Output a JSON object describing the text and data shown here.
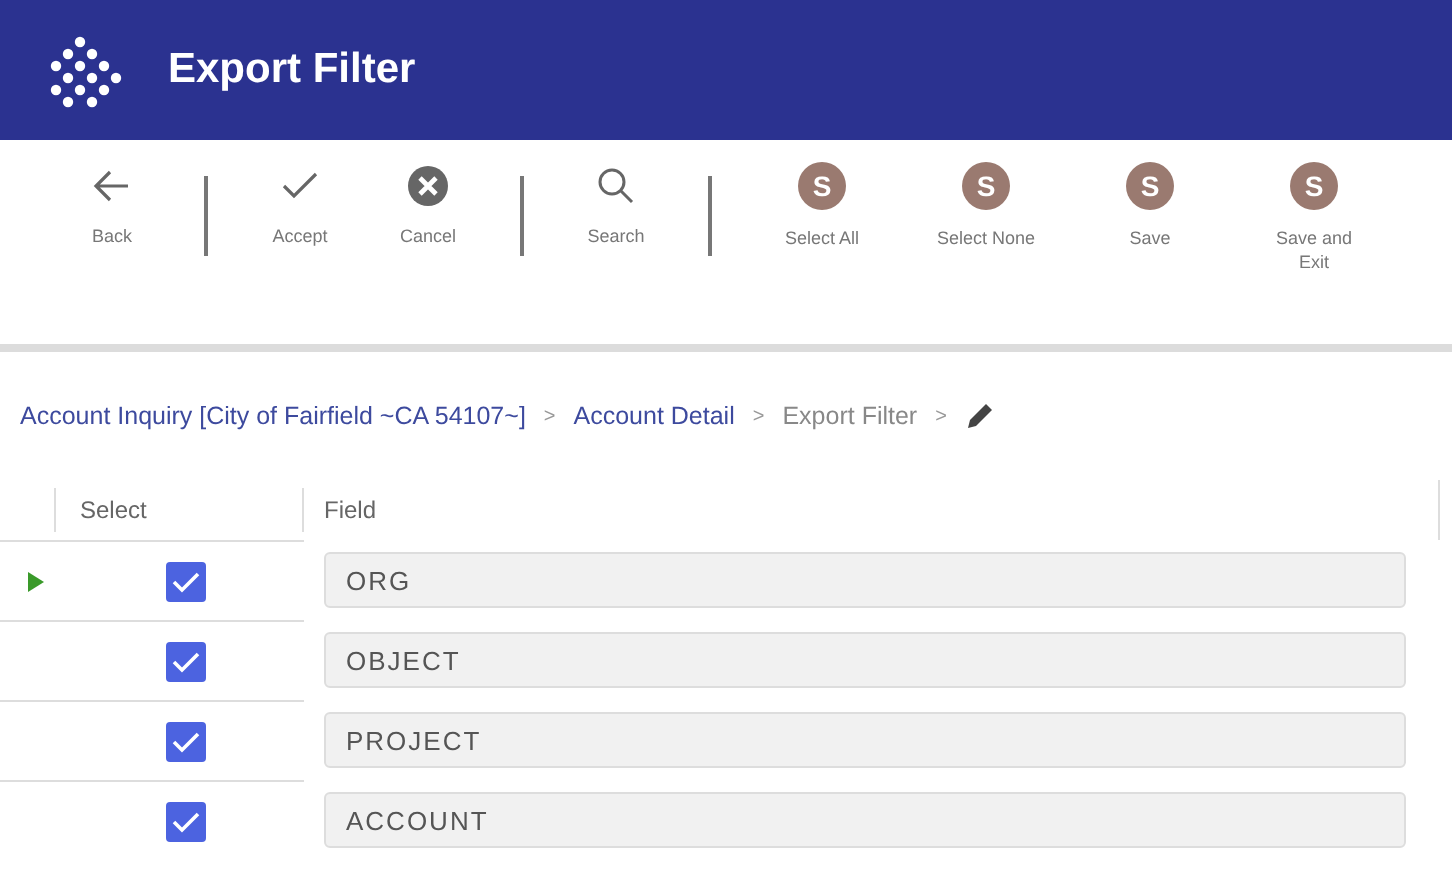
{
  "window": {
    "title": "Export Filter"
  },
  "toolbar": {
    "groups": [
      {
        "buttons": [
          {
            "label": "Back",
            "kind": "back"
          }
        ]
      },
      {
        "buttons": [
          {
            "label": "Accept",
            "kind": "accept"
          },
          {
            "label": "Cancel",
            "kind": "cancel"
          }
        ]
      },
      {
        "buttons": [
          {
            "label": "Search",
            "kind": "search"
          }
        ]
      },
      {
        "buttons": [
          {
            "label": "Select All",
            "kind": "letter",
            "letter": "S"
          },
          {
            "label": "Select None",
            "kind": "letter",
            "letter": "S"
          },
          {
            "label": "Save",
            "kind": "letter",
            "letter": "S"
          },
          {
            "label": "Save and Exit",
            "kind": "letter",
            "letter": "S"
          }
        ]
      }
    ]
  },
  "breadcrumbs": [
    {
      "label": "Account Inquiry [City of Fairfield ~CA 54107~]",
      "current": false,
      "separator": ">"
    },
    {
      "label": "Account Detail",
      "current": false,
      "separator": ">"
    },
    {
      "label": "Export Filter",
      "current": true,
      "separator": ">"
    }
  ],
  "table": {
    "columns": [
      "Select",
      "Field"
    ],
    "rows": [
      {
        "current": true,
        "checked": true,
        "field": "ORG"
      },
      {
        "current": false,
        "checked": true,
        "field": "OBJECT"
      },
      {
        "current": false,
        "checked": true,
        "field": "PROJECT"
      },
      {
        "current": false,
        "checked": true,
        "field": "ACCOUNT"
      }
    ]
  }
}
